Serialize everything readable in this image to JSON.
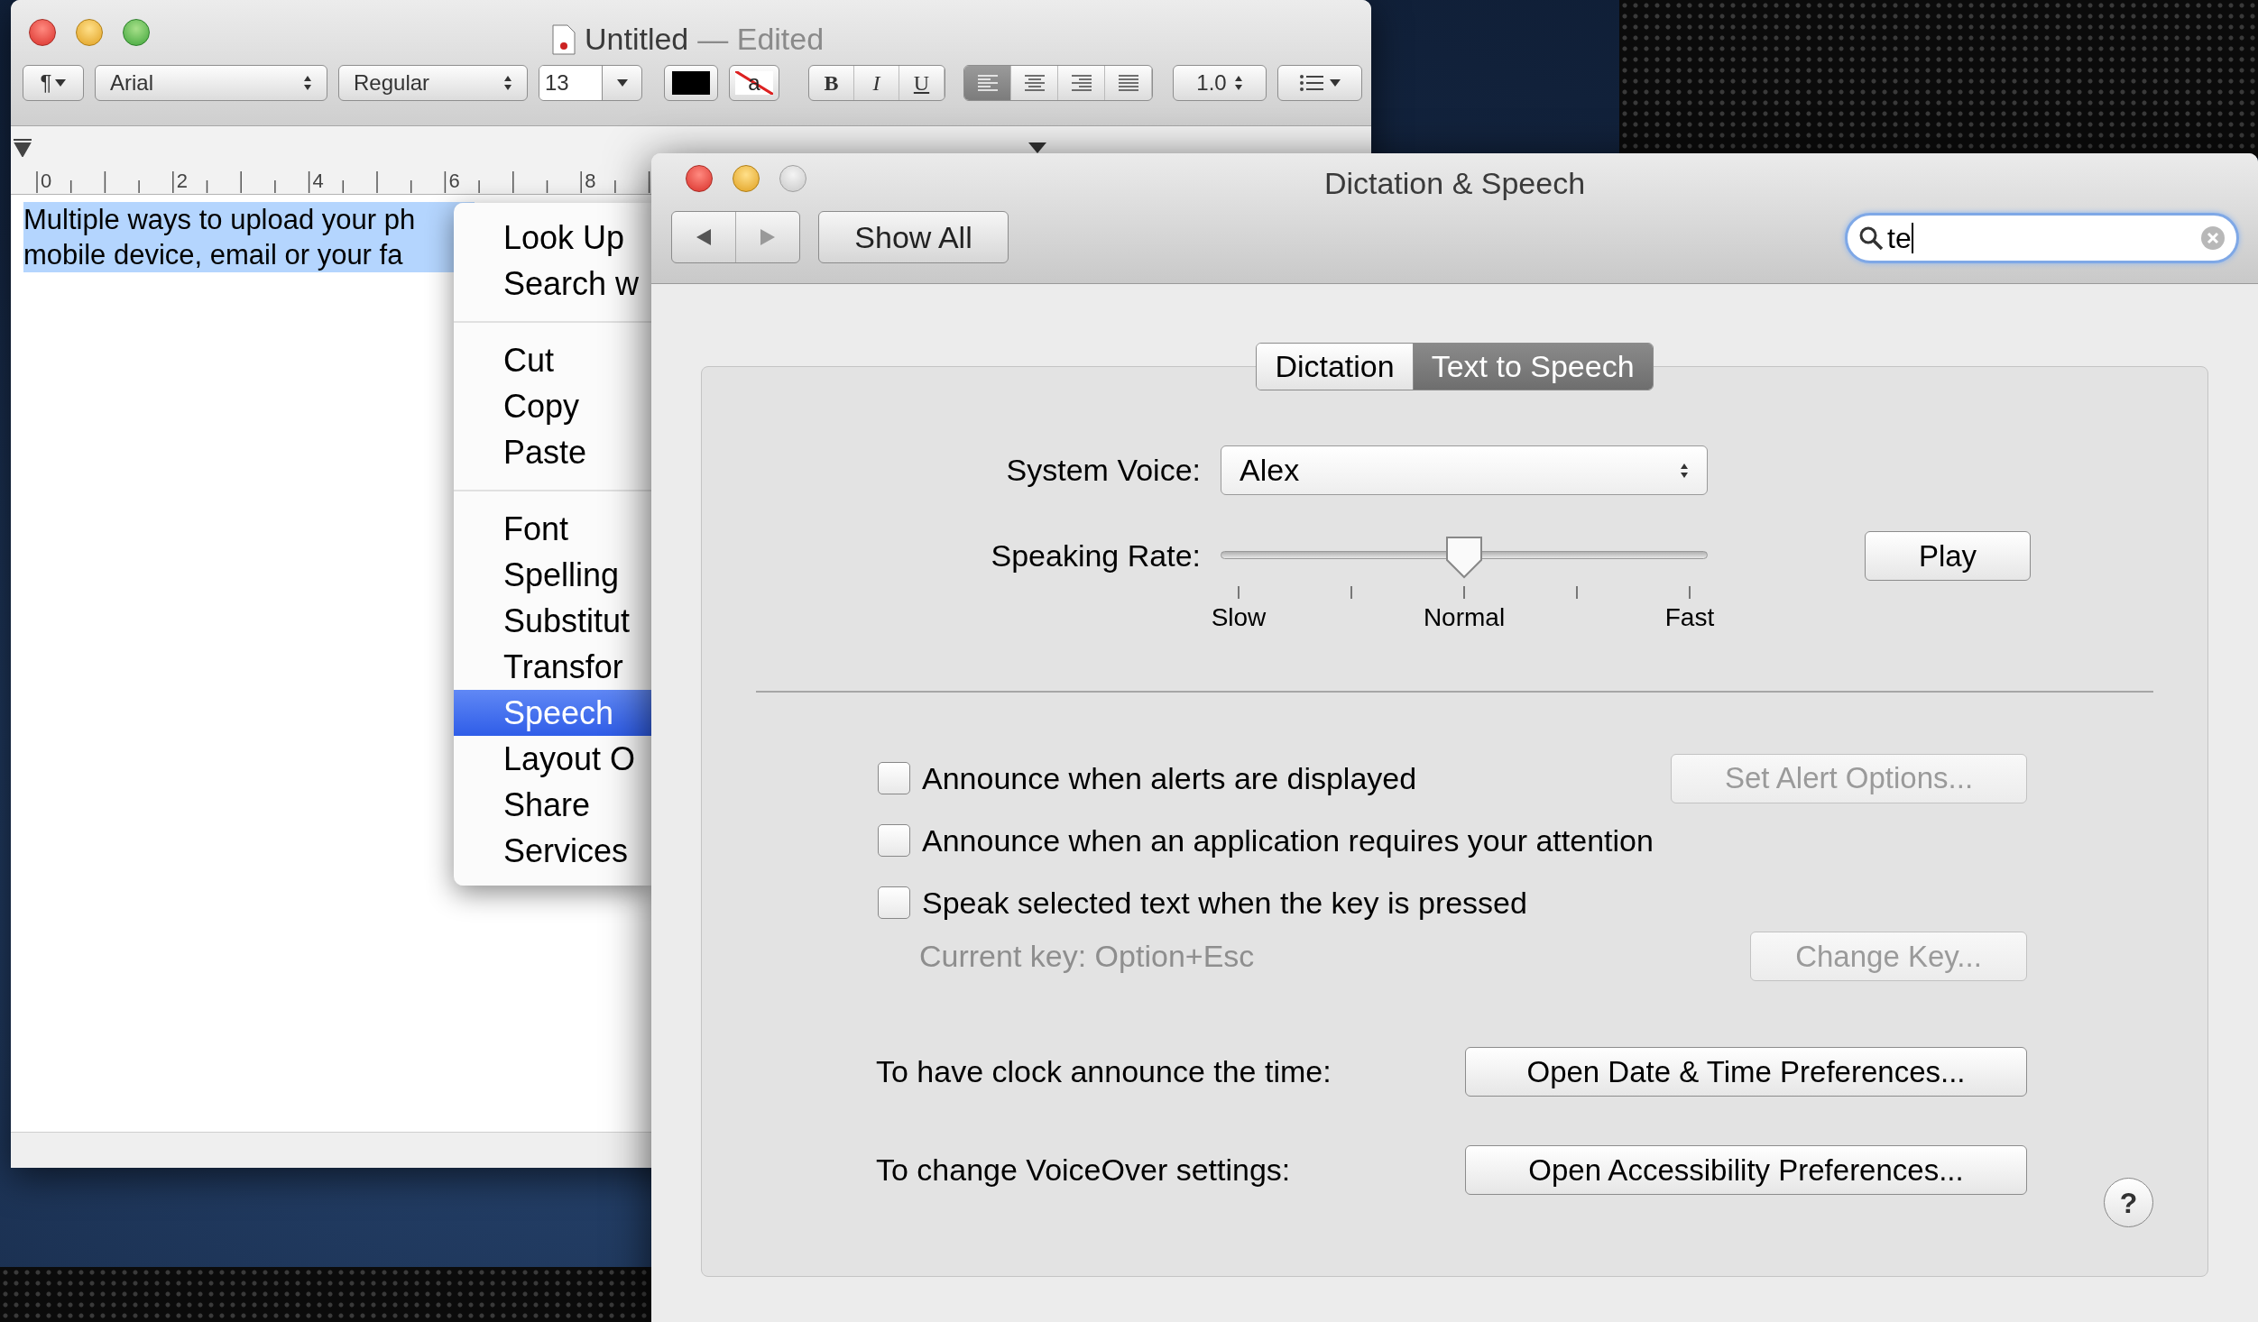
{
  "textedit": {
    "title": "Untitled",
    "status": "— Edited",
    "toolbar": {
      "paragraph": "¶",
      "font": "Arial",
      "style": "Regular",
      "size": "13",
      "background_letter": "a",
      "format": [
        {
          "label": "B",
          "kind": "bold",
          "selected": false
        },
        {
          "label": "I",
          "kind": "italic",
          "selected": false
        },
        {
          "label": "U",
          "kind": "underline",
          "selected": false
        }
      ],
      "alignment": [
        {
          "kind": "left",
          "selected": true
        },
        {
          "kind": "center",
          "selected": false
        },
        {
          "kind": "right",
          "selected": false
        },
        {
          "kind": "justify",
          "selected": false
        }
      ],
      "spacing": "1.0"
    },
    "ruler": [
      "0",
      "2",
      "4",
      "6",
      "8"
    ],
    "text": {
      "selected": true,
      "lines": [
        "Multiple ways to upload your ph",
        "mobile device, email or your fa"
      ]
    }
  },
  "context_menu": {
    "groups": [
      [
        {
          "label": "Look Up",
          "selected": false
        },
        {
          "label": "Search w",
          "selected": false
        }
      ],
      [
        {
          "label": "Cut",
          "selected": false
        },
        {
          "label": "Copy",
          "selected": false
        },
        {
          "label": "Paste",
          "selected": false
        }
      ],
      [
        {
          "label": "Font",
          "selected": false
        },
        {
          "label": "Spelling",
          "selected": false
        },
        {
          "label": "Substitut",
          "selected": false
        },
        {
          "label": "Transfor",
          "selected": false
        },
        {
          "label": "Speech",
          "selected": true
        },
        {
          "label": "Layout O",
          "selected": false
        },
        {
          "label": "Share",
          "selected": false
        },
        {
          "label": "Services",
          "selected": false
        }
      ]
    ]
  },
  "preferences": {
    "title": "Dictation & Speech",
    "show_all": "Show All",
    "search": {
      "value": "te"
    },
    "tabs": [
      {
        "label": "Dictation",
        "selected": false
      },
      {
        "label": "Text to Speech",
        "selected": true
      }
    ],
    "system_voice": {
      "label": "System Voice:",
      "value": "Alex"
    },
    "speaking_rate": {
      "label": "Speaking Rate:",
      "level": 0.5,
      "ticks": [
        "Slow",
        "Normal",
        "Fast"
      ]
    },
    "play": "Play",
    "options": [
      {
        "label": "Announce when alerts are displayed",
        "checked": false,
        "button": {
          "label": "Set Alert Options...",
          "disabled": true
        }
      },
      {
        "label": "Announce when an application requires your attention",
        "checked": false
      },
      {
        "label": "Speak selected text when the key is pressed",
        "checked": false,
        "note": {
          "text": "Current key: Option+Esc",
          "disabled": true
        },
        "button": {
          "label": "Change Key...",
          "disabled": true
        }
      }
    ],
    "links": [
      {
        "label": "To have clock announce the time:",
        "button": "Open Date & Time Preferences..."
      },
      {
        "label": "To change VoiceOver settings:",
        "button": "Open Accessibility Preferences..."
      }
    ],
    "help": "?"
  }
}
